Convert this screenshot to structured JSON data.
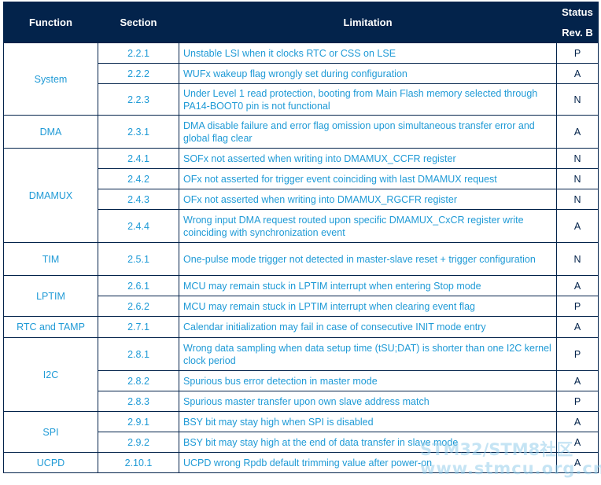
{
  "header": {
    "function": "Function",
    "section": "Section",
    "limitation": "Limitation",
    "status": "Status",
    "revision": "Rev. B"
  },
  "groups": [
    {
      "function": "System",
      "rows": [
        {
          "section": "2.2.1",
          "limitation": "Unstable LSI when it clocks RTC or CSS on LSE",
          "status": "P"
        },
        {
          "section": "2.2.2",
          "limitation": "WUFx wakeup flag wrongly set during configuration",
          "status": "A"
        },
        {
          "section": "2.2.3",
          "limitation": "Under Level 1 read protection, booting from Main Flash memory selected through PA14-BOOT0 pin is not functional",
          "status": "N"
        }
      ]
    },
    {
      "function": "DMA",
      "rows": [
        {
          "section": "2.3.1",
          "limitation": "DMA disable failure and error flag omission upon simultaneous transfer error and global flag clear",
          "status": "A"
        }
      ]
    },
    {
      "function": "DMAMUX",
      "rows": [
        {
          "section": "2.4.1",
          "limitation": "SOFx not asserted when writing into DMAMUX_CCFR register",
          "status": "N"
        },
        {
          "section": "2.4.2",
          "limitation": "OFx not asserted for trigger event coinciding with last DMAMUX request",
          "status": "N"
        },
        {
          "section": "2.4.3",
          "limitation": "OFx not asserted when writing into DMAMUX_RGCFR register",
          "status": "N"
        },
        {
          "section": "2.4.4",
          "limitation": "Wrong input DMA request routed upon specific DMAMUX_CxCR register write coinciding with synchronization event",
          "status": "A"
        }
      ]
    },
    {
      "function": "TIM",
      "rows": [
        {
          "section": "2.5.1",
          "limitation": "One-pulse mode trigger not detected in master-slave reset + trigger configuration",
          "status": "N"
        }
      ]
    },
    {
      "function": "LPTIM",
      "rows": [
        {
          "section": "2.6.1",
          "limitation": "MCU may remain stuck in LPTIM interrupt when entering Stop mode",
          "status": "A"
        },
        {
          "section": "2.6.2",
          "limitation": "MCU may remain stuck in LPTIM interrupt when clearing event flag",
          "status": "P"
        }
      ]
    },
    {
      "function": "RTC and TAMP",
      "rows": [
        {
          "section": "2.7.1",
          "limitation": "Calendar initialization may fail in case of consecutive INIT mode entry",
          "status": "A"
        }
      ]
    },
    {
      "function": "I2C",
      "rows": [
        {
          "section": "2.8.1",
          "limitation": "Wrong data sampling when data setup time (tSU;DAT) is shorter than one I2C kernel clock period",
          "status": "P"
        },
        {
          "section": "2.8.2",
          "limitation": "Spurious bus error detection in master mode",
          "status": "A"
        },
        {
          "section": "2.8.3",
          "limitation": "Spurious master transfer upon own slave address match",
          "status": "P"
        }
      ]
    },
    {
      "function": "SPI",
      "rows": [
        {
          "section": "2.9.1",
          "limitation": "BSY bit may stay high when SPI is disabled",
          "status": "A"
        },
        {
          "section": "2.9.2",
          "limitation": "BSY bit may stay high at the end of data transfer in slave mode",
          "status": "A"
        }
      ]
    },
    {
      "function": "UCPD",
      "rows": [
        {
          "section": "2.10.1",
          "limitation": "UCPD wrong Rpdb default trimming value after power-on",
          "status": "A"
        }
      ]
    }
  ],
  "watermark": {
    "line1": "STM32/STM8社区",
    "line2": "www.stmcu.org.cn"
  }
}
